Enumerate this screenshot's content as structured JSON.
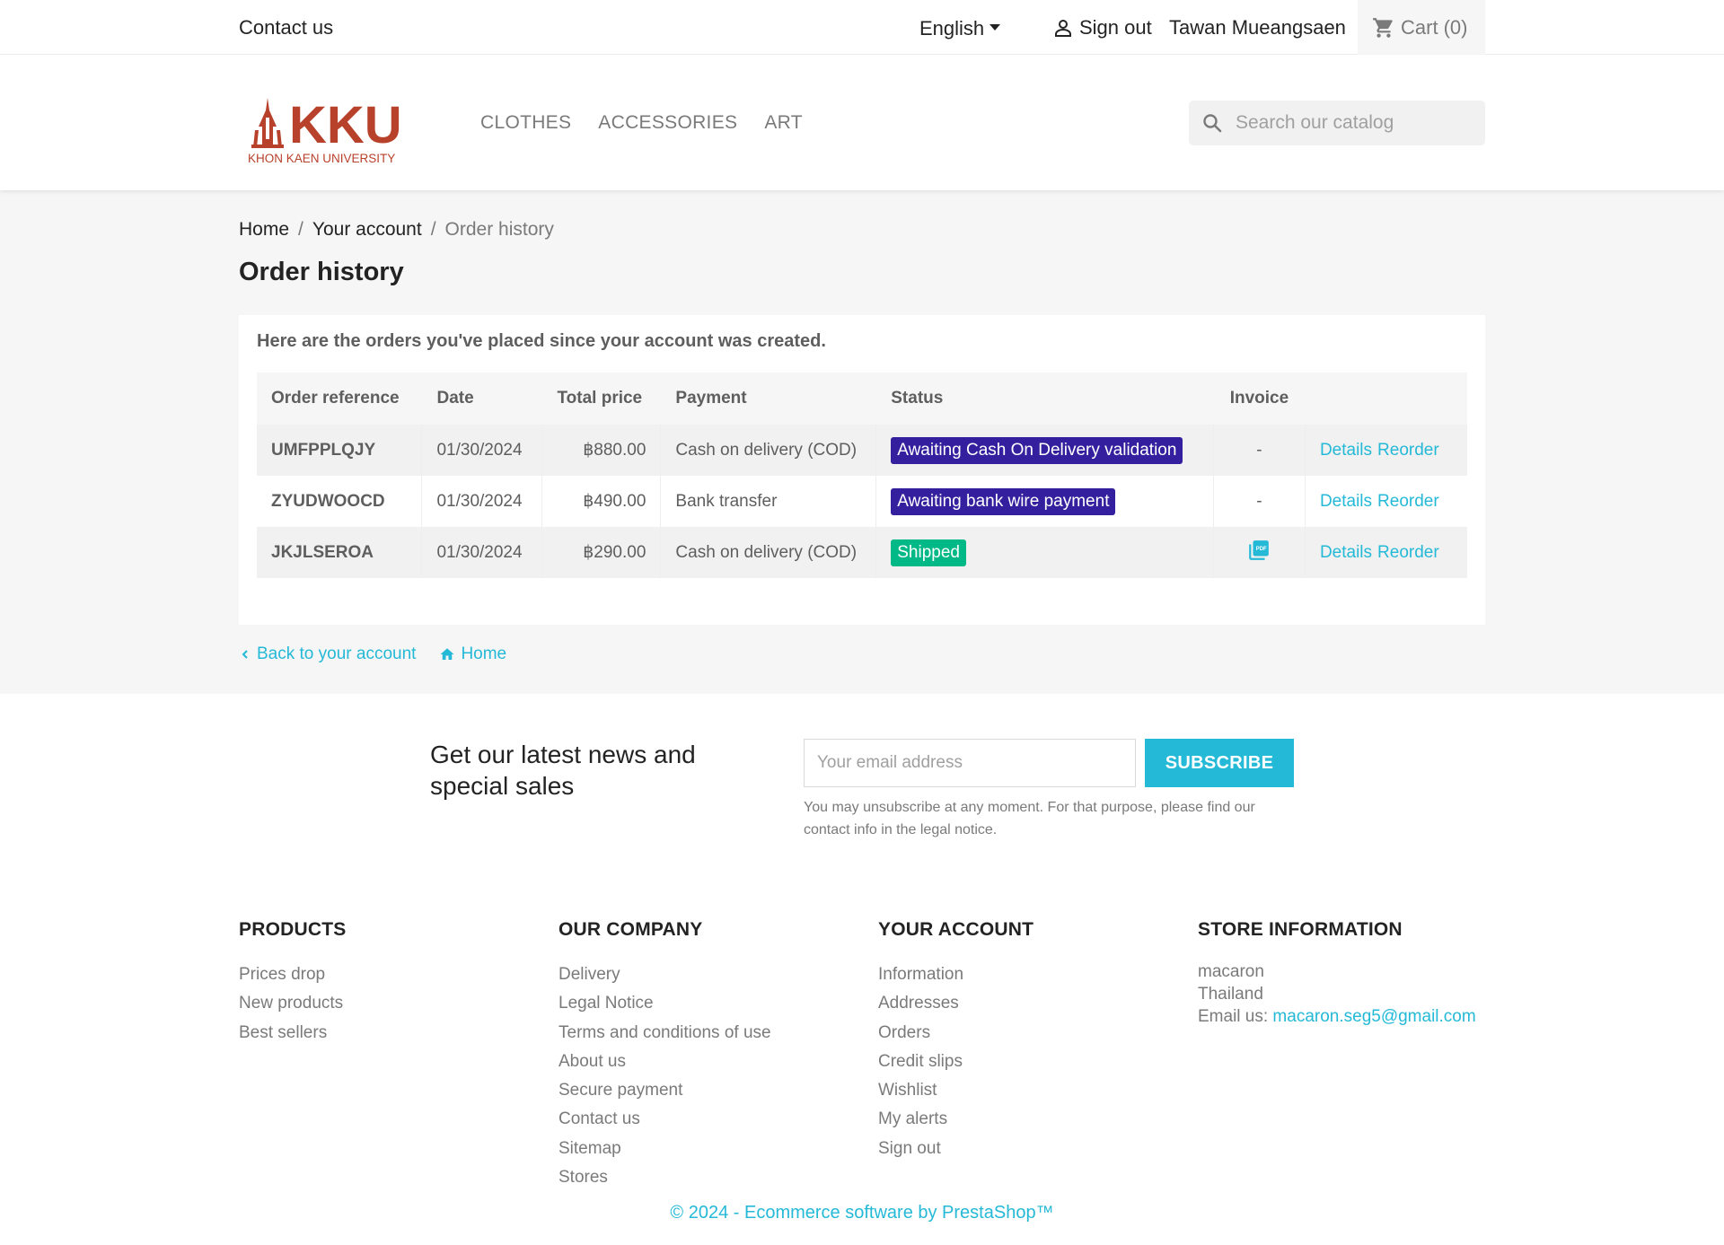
{
  "topnav": {
    "contact": "Contact us",
    "language": "English",
    "signout": "Sign out",
    "username": "Tawan Mueangsaen",
    "cart": "Cart",
    "cart_count": "(0)"
  },
  "header": {
    "logo_text": "KKU",
    "logo_subtext": "KHON KAEN UNIVERSITY",
    "menu": [
      "CLOTHES",
      "ACCESSORIES",
      "ART"
    ],
    "search_placeholder": "Search our catalog"
  },
  "breadcrumb": [
    "Home",
    "Your account",
    "Order history"
  ],
  "page_title": "Order history",
  "intro": "Here are the orders you've placed since your account was created.",
  "table": {
    "headers": [
      "Order reference",
      "Date",
      "Total price",
      "Payment",
      "Status",
      "Invoice",
      ""
    ],
    "rows": [
      {
        "ref": "UMFPPLQJY",
        "date": "01/30/2024",
        "price": "฿880.00",
        "payment": "Cash on delivery (COD)",
        "status": "Awaiting Cash On Delivery validation",
        "status_color": "#34209e",
        "invoice": "-",
        "details": "Details",
        "reorder": "Reorder"
      },
      {
        "ref": "ZYUDWOOCD",
        "date": "01/30/2024",
        "price": "฿490.00",
        "payment": "Bank transfer",
        "status": "Awaiting bank wire payment",
        "status_color": "#34209e",
        "invoice": "-",
        "details": "Details",
        "reorder": "Reorder"
      },
      {
        "ref": "JKJLSEROA",
        "date": "01/30/2024",
        "price": "฿290.00",
        "payment": "Cash on delivery (COD)",
        "status": "Shipped",
        "status_color": "#01b887",
        "invoice": "pdf-icon",
        "details": "Details",
        "reorder": "Reorder"
      }
    ]
  },
  "page_links": {
    "back": "Back to your account",
    "home": "Home"
  },
  "newsletter": {
    "title": "Get our latest news and special sales",
    "placeholder": "Your email address",
    "button": "SUBSCRIBE",
    "note": "You may unsubscribe at any moment. For that purpose, please find our contact info in the legal notice."
  },
  "footer": {
    "products": {
      "title": "PRODUCTS",
      "items": [
        "Prices drop",
        "New products",
        "Best sellers"
      ]
    },
    "company": {
      "title": "OUR COMPANY",
      "items": [
        "Delivery",
        "Legal Notice",
        "Terms and conditions of use",
        "About us",
        "Secure payment",
        "Contact us",
        "Sitemap",
        "Stores"
      ]
    },
    "account": {
      "title": "YOUR ACCOUNT",
      "items": [
        "Information",
        "Addresses",
        "Orders",
        "Credit slips",
        "Wishlist",
        "My alerts",
        "Sign out"
      ]
    },
    "store": {
      "title": "STORE INFORMATION",
      "name": "macaron",
      "country": "Thailand",
      "email_label": "Email us:",
      "email": "macaron.seg5@gmail.com"
    },
    "copyright": "© 2024 - Ecommerce software by PrestaShop™"
  },
  "colors": {
    "accent": "#24b9d7",
    "status_awaiting": "#34209e",
    "status_shipped": "#01b887",
    "logo_red": "#b8412b"
  }
}
